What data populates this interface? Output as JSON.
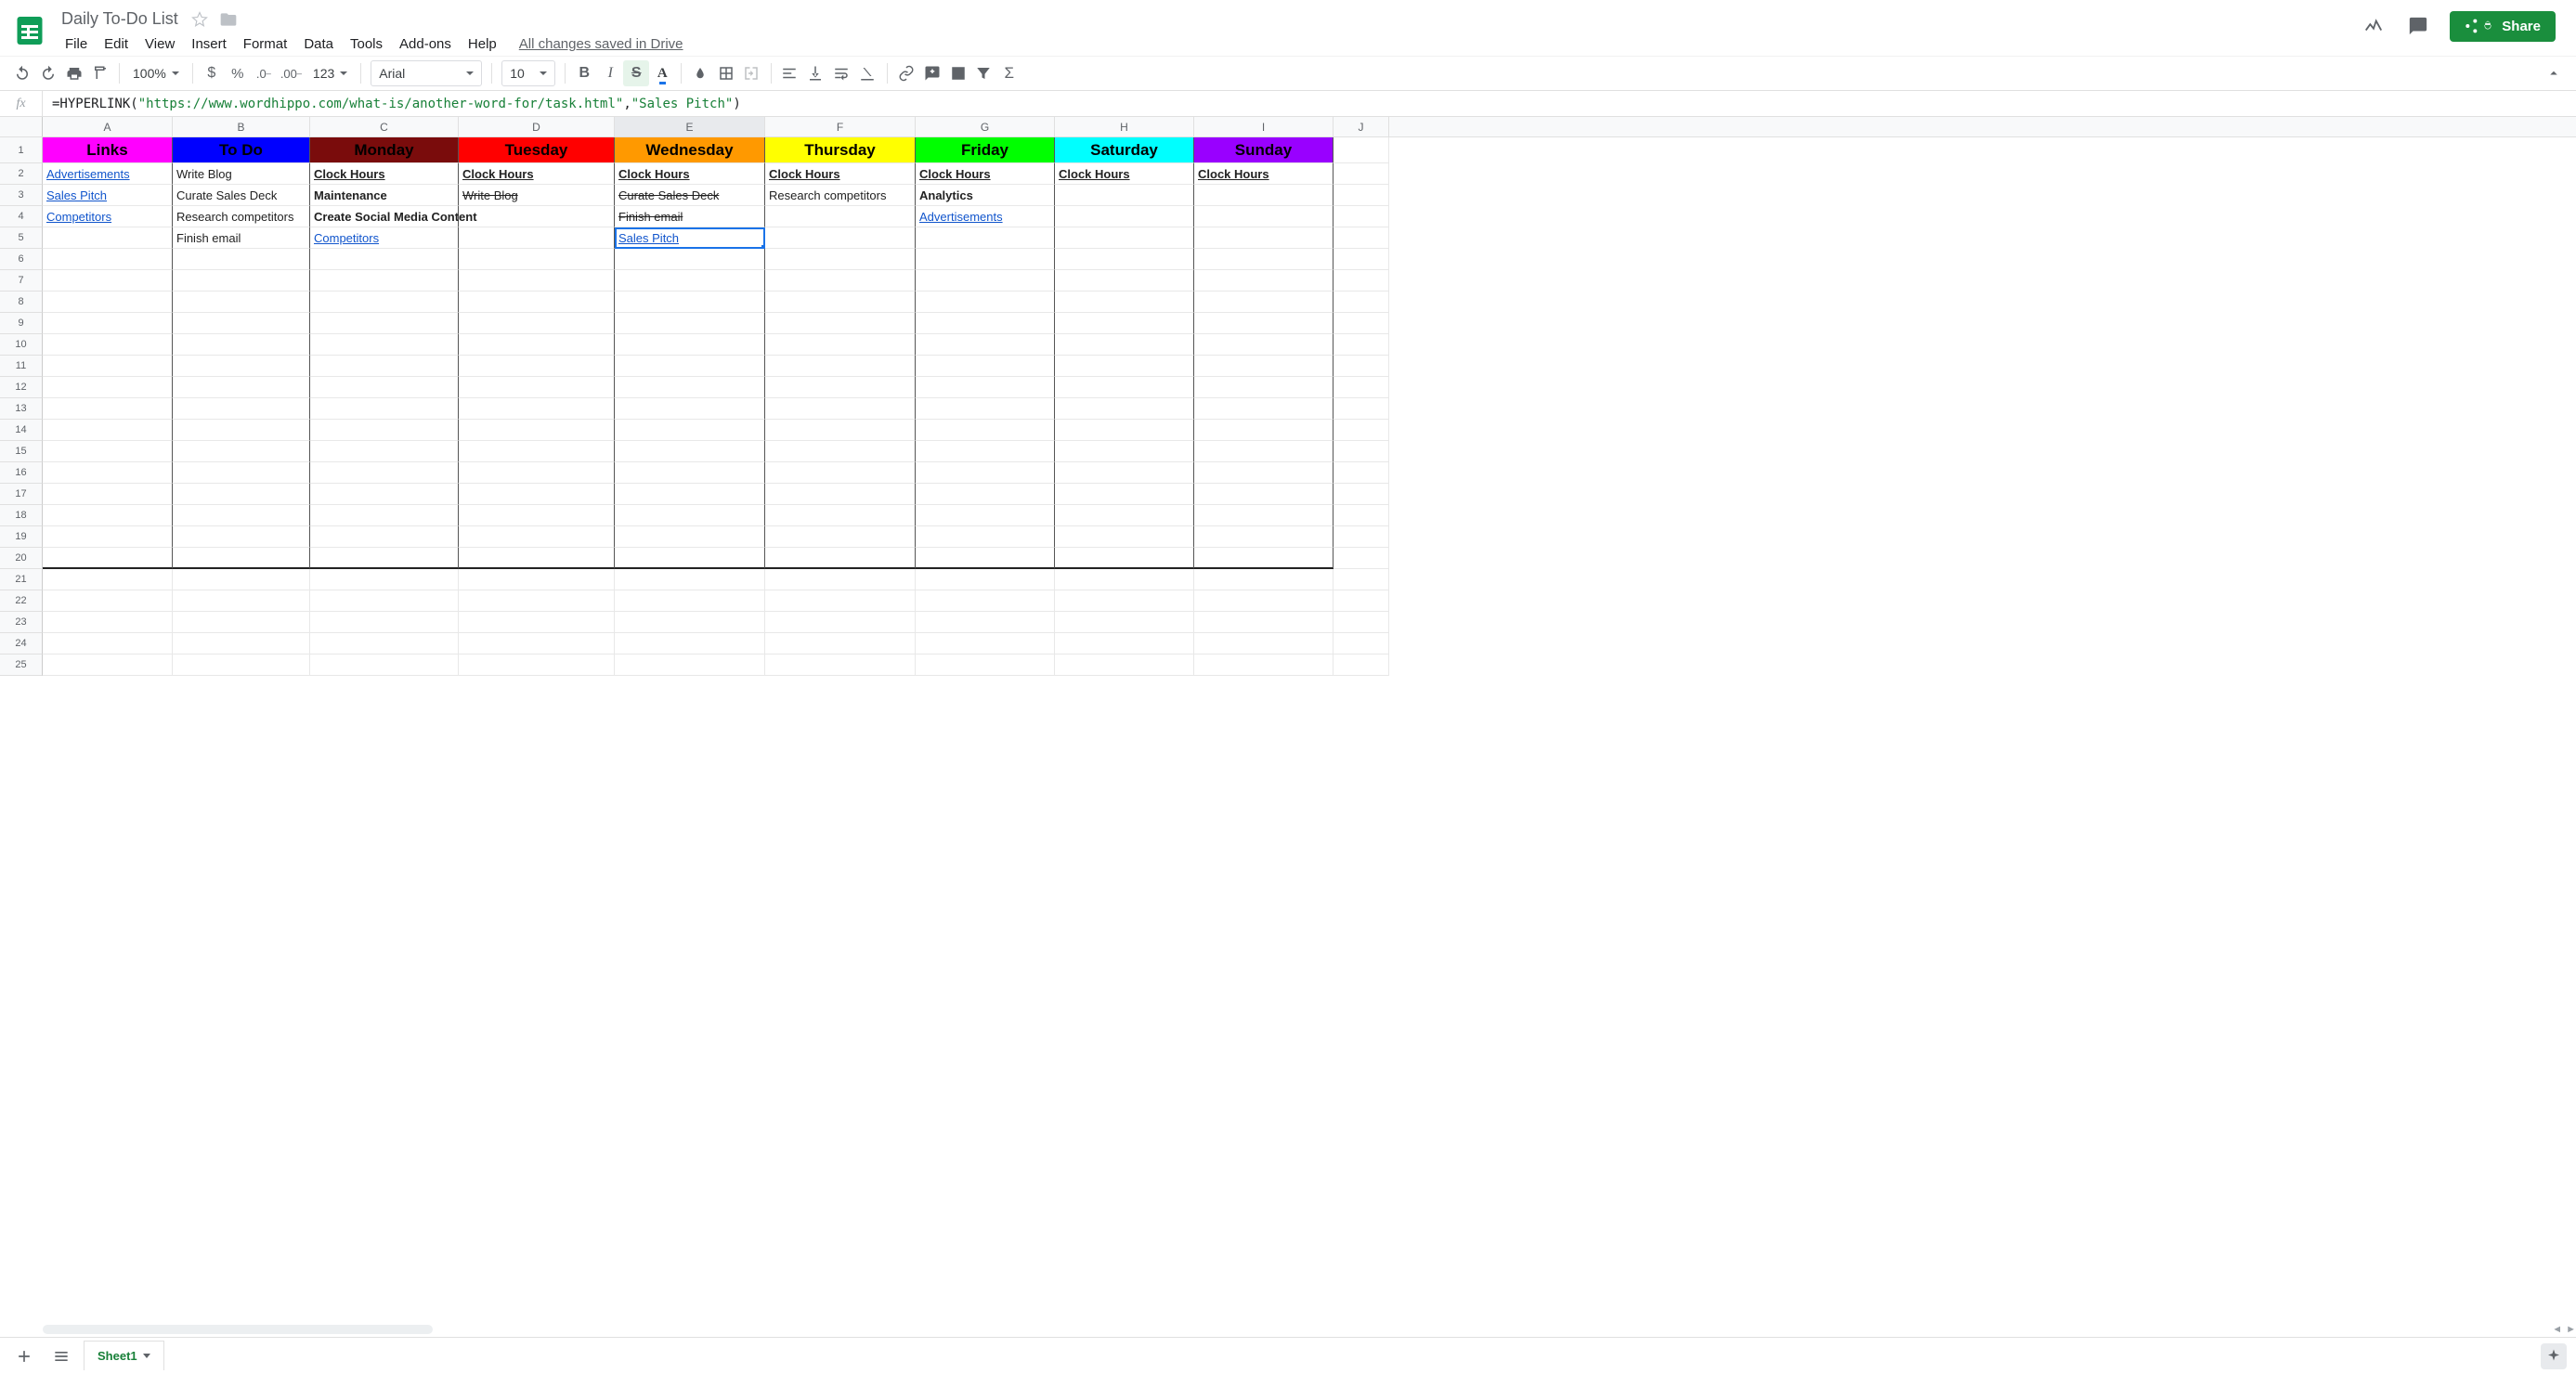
{
  "doc": {
    "title": "Daily To-Do List",
    "drive_status": "All changes saved in Drive"
  },
  "menus": [
    "File",
    "Edit",
    "View",
    "Insert",
    "Format",
    "Data",
    "Tools",
    "Add-ons",
    "Help"
  ],
  "share_label": "Share",
  "toolbar": {
    "zoom": "100%",
    "font": "Arial",
    "font_size": "10",
    "more_formats": "123"
  },
  "formula": {
    "prefix": "=HYPERLINK(",
    "arg1": "\"https://www.wordhippo.com/what-is/another-word-for/task.html\"",
    "comma": ",",
    "arg2": "\"Sales Pitch\"",
    "suffix": ")"
  },
  "columns": [
    {
      "id": "A",
      "w": 140,
      "hdr": "Links",
      "hcls": "hdr-links"
    },
    {
      "id": "B",
      "w": 148,
      "hdr": "To Do",
      "hcls": "hdr-todo"
    },
    {
      "id": "C",
      "w": 160,
      "hdr": "Monday",
      "hcls": "hdr-mon"
    },
    {
      "id": "D",
      "w": 168,
      "hdr": "Tuesday",
      "hcls": "hdr-tue"
    },
    {
      "id": "E",
      "w": 162,
      "hdr": "Wednesday",
      "hcls": "hdr-wed"
    },
    {
      "id": "F",
      "w": 162,
      "hdr": "Thursday",
      "hcls": "hdr-thu"
    },
    {
      "id": "G",
      "w": 150,
      "hdr": "Friday",
      "hcls": "hdr-fri"
    },
    {
      "id": "H",
      "w": 150,
      "hdr": "Saturday",
      "hcls": "hdr-sat"
    },
    {
      "id": "I",
      "w": 150,
      "hdr": "Sunday",
      "hcls": "hdr-sun"
    },
    {
      "id": "J",
      "w": 60,
      "hdr": "",
      "hcls": ""
    }
  ],
  "rows_visible": 25,
  "selected_col": "E",
  "clockhours": "Clock Hours",
  "cells": {
    "A2": {
      "t": "Advertisements",
      "cls": "link"
    },
    "A3": {
      "t": "Sales Pitch",
      "cls": "link"
    },
    "A4": {
      "t": "Competitors",
      "cls": "link"
    },
    "B2": {
      "t": "Write Blog"
    },
    "B3": {
      "t": "Curate Sales Deck"
    },
    "B4": {
      "t": "Research competitors"
    },
    "B5": {
      "t": "Finish email"
    },
    "C2": {
      "t": "Clock Hours",
      "cls": "bold under"
    },
    "C3": {
      "t": "Maintenance",
      "cls": "bold"
    },
    "C4": {
      "t": "Create Social Media Content",
      "cls": "bold"
    },
    "C5": {
      "t": "Competitors",
      "cls": "link strike"
    },
    "D2": {
      "t": "Clock Hours",
      "cls": "bold under"
    },
    "D3": {
      "t": "Write Blog",
      "cls": "strike"
    },
    "E2": {
      "t": "Clock Hours",
      "cls": "bold under"
    },
    "E3": {
      "t": "Curate Sales Deck",
      "cls": "strike"
    },
    "E4": {
      "t": "Finish email",
      "cls": "strike"
    },
    "E5": {
      "t": "Sales Pitch",
      "cls": "link strike",
      "selected": true
    },
    "F2": {
      "t": "Clock Hours",
      "cls": "bold under"
    },
    "F3": {
      "t": "Research competitors"
    },
    "G2": {
      "t": "Clock Hours",
      "cls": "bold under"
    },
    "G3": {
      "t": "Analytics",
      "cls": "bold"
    },
    "G4": {
      "t": "Advertisements",
      "cls": "link"
    },
    "H2": {
      "t": "Clock Hours",
      "cls": "bold under"
    },
    "I2": {
      "t": "Clock Hours",
      "cls": "bold under"
    }
  },
  "sheet_tab": "Sheet1"
}
